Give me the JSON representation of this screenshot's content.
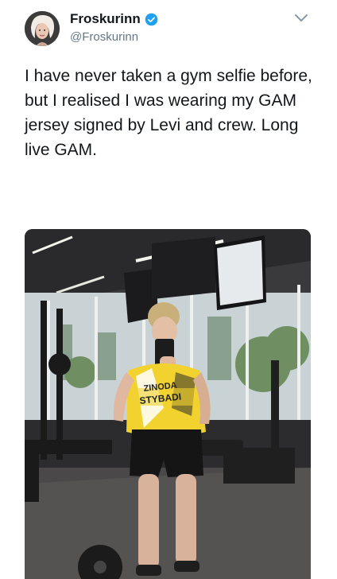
{
  "tweet": {
    "author": {
      "display_name": "Froskurinn",
      "handle": "@Froskurinn",
      "verified": true,
      "avatar_icon": "avatar-icon"
    },
    "text": "I have never taken a gym selfie before, but I realised I was wearing my GAM jersey signed by Levi and crew. Long live GAM.",
    "menu_icon": "chevron-down-icon",
    "media": {
      "description_icon": "photo",
      "jersey_text": "ZINODA\nSTYBADI"
    }
  },
  "colors": {
    "verified_blue": "#1da1f2",
    "handle_gray": "#657786",
    "text": "#14171a",
    "jersey_yellow": "#f2d22e"
  }
}
